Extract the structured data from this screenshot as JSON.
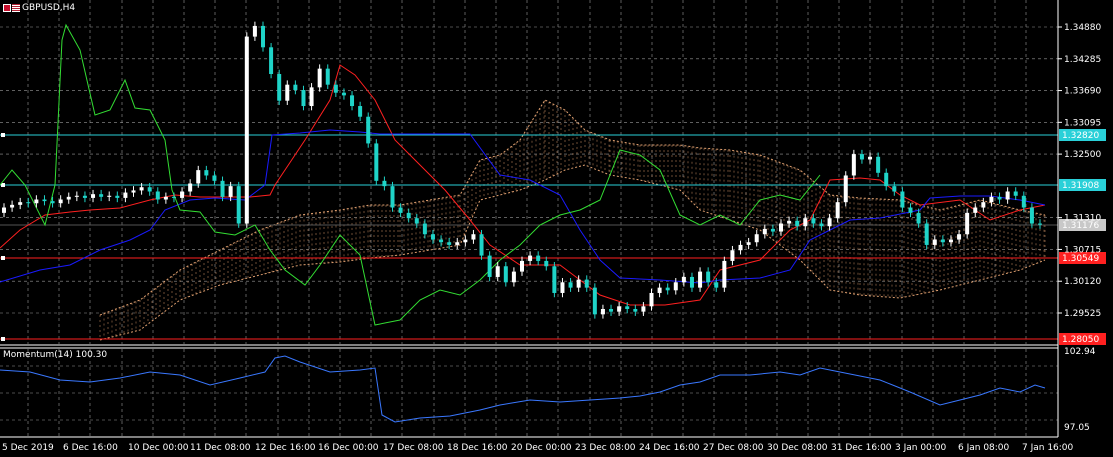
{
  "chart_title": "GBPUSD,H4",
  "indicator_title": "Momentum(14) 100.30",
  "colors": {
    "background": "#000000",
    "grid": "#9a9a9a",
    "bull_candle": "#ffffff",
    "bear_candle": "#1fd4c8",
    "kijun": "#ff2020",
    "tenkan": "#1a1aff",
    "chikou": "#33dd33",
    "cloud": "#e0a070",
    "momentum": "#3a78ff",
    "hline_cyan": "#2ad0d8",
    "hline_red": "#ff2020"
  },
  "price_axis": {
    "ticks": [
      "1.34880",
      "1.34285",
      "1.33690",
      "1.33095",
      "1.32500",
      "1.31310",
      "1.30715",
      "1.30120",
      "1.29525"
    ],
    "highlight_labels": [
      {
        "text": "1.32820",
        "style": "cyan"
      },
      {
        "text": "1.31908",
        "style": "cyan"
      },
      {
        "text": "1.31176",
        "style": "gray"
      },
      {
        "text": "1.30549",
        "style": "red"
      },
      {
        "text": "1.28050",
        "style": "red"
      }
    ]
  },
  "momentum_axis": {
    "ticks": [
      "102.94",
      "97.05"
    ]
  },
  "time_axis": {
    "labels": [
      "5 Dec 2019",
      "6 Dec 16:00",
      "10 Dec 00:00",
      "11 Dec 08:00",
      "12 Dec 16:00",
      "16 Dec 00:00",
      "17 Dec 08:00",
      "18 Dec 16:00",
      "20 Dec 00:00",
      "23 Dec 08:00",
      "24 Dec 16:00",
      "27 Dec 08:00",
      "30 Dec 08:00",
      "31 Dec 16:00",
      "3 Jan 00:00",
      "6 Jan 08:00",
      "7 Jan 16:00"
    ]
  }
}
